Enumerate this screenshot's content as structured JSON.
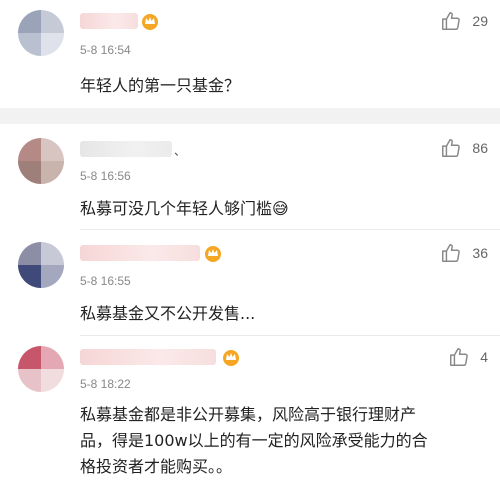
{
  "comments": [
    {
      "time": "5-8 16:54",
      "text": "年轻人的第一只基金？",
      "likes": "29",
      "badge": "crown-icon"
    },
    {
      "name_suffix": "、",
      "time": "5-8 16:56",
      "text": "私募可没几个年轻人够门槛😅",
      "likes": "86"
    },
    {
      "time": "5-8 16:55",
      "text": "私募基金又不公开发售...",
      "likes": "36",
      "badge": "crown-icon"
    },
    {
      "time": "5-8 18:22",
      "text_lines": [
        "私募基金都是非公开募集，风险高于银行理财产",
        "品，得是100w以上的有一定的风险承受能力的合",
        "格投资者才能购买。。"
      ],
      "likes": "4",
      "badge": "crown-icon"
    }
  ],
  "colors": {
    "background": "#ffffff",
    "separator": "#f2f2f2",
    "badge": "#f5a623",
    "icon": "#888888"
  }
}
